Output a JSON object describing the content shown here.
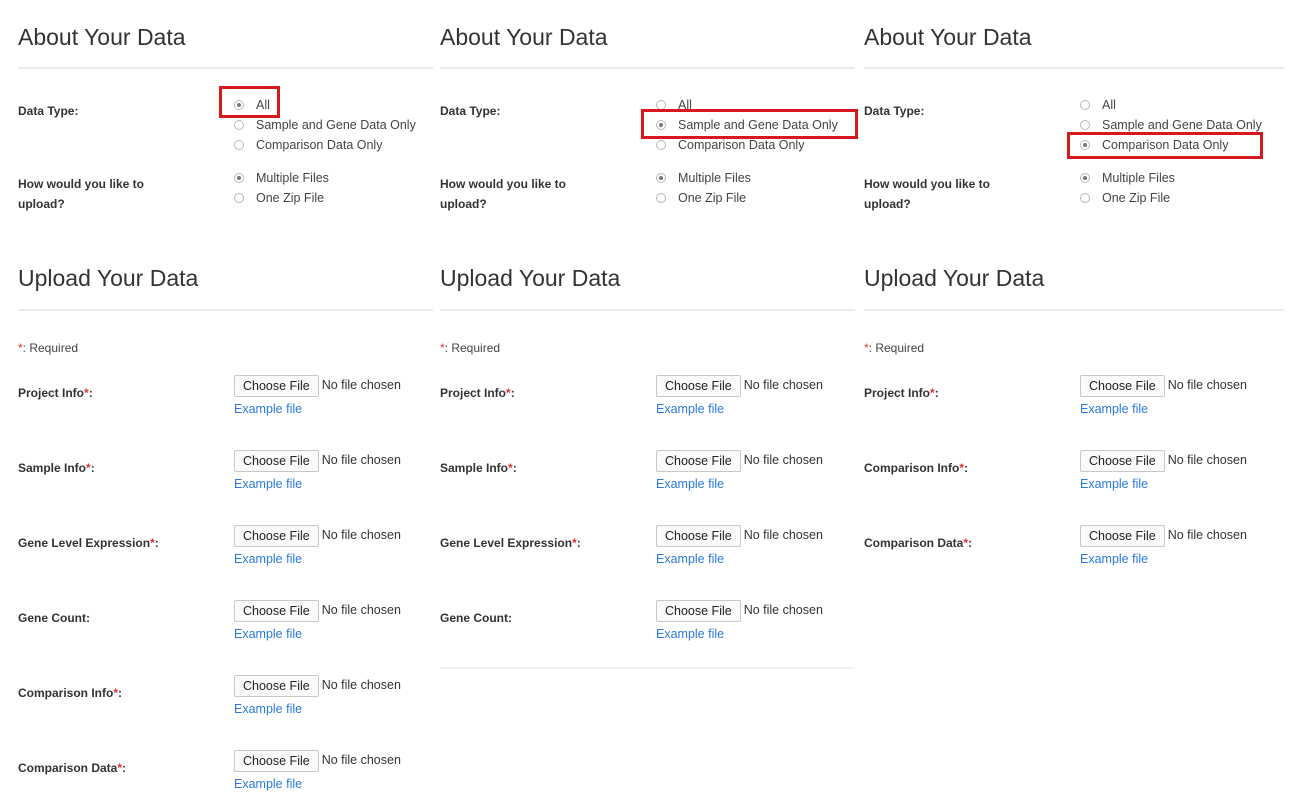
{
  "panels": [
    {
      "about_title": "About Your Data",
      "data_type_label": "Data Type:",
      "data_type_options": [
        "All",
        "Sample and Gene Data Only",
        "Comparison Data Only"
      ],
      "data_type_selected": 0,
      "upload_method_label": "How would you like to upload?",
      "upload_method_options": [
        "Multiple Files",
        "One Zip File"
      ],
      "upload_method_selected": 0,
      "upload_title": "Upload Your Data",
      "required_note": ": Required",
      "fields": [
        {
          "label": "Project Info",
          "required": true,
          "button": "Choose File",
          "status": "No file chosen",
          "example": "Example file"
        },
        {
          "label": "Sample Info",
          "required": true,
          "button": "Choose File",
          "status": "No file chosen",
          "example": "Example file"
        },
        {
          "label": "Gene Level Expression",
          "required": true,
          "button": "Choose File",
          "status": "No file chosen",
          "example": "Example file"
        },
        {
          "label": "Gene Count",
          "required": false,
          "button": "Choose File",
          "status": "No file chosen",
          "example": "Example file"
        },
        {
          "label": "Comparison Info",
          "required": true,
          "button": "Choose File",
          "status": "No file chosen",
          "example": "Example file"
        },
        {
          "label": "Comparison Data",
          "required": true,
          "button": "Choose File",
          "status": "No file chosen",
          "example": "Example file"
        }
      ]
    },
    {
      "about_title": "About Your Data",
      "data_type_label": "Data Type:",
      "data_type_options": [
        "All",
        "Sample and Gene Data Only",
        "Comparison Data Only"
      ],
      "data_type_selected": 1,
      "upload_method_label": "How would you like to upload?",
      "upload_method_options": [
        "Multiple Files",
        "One Zip File"
      ],
      "upload_method_selected": 0,
      "upload_title": "Upload Your Data",
      "required_note": ": Required",
      "fields": [
        {
          "label": "Project Info",
          "required": true,
          "button": "Choose File",
          "status": "No file chosen",
          "example": "Example file"
        },
        {
          "label": "Sample Info",
          "required": true,
          "button": "Choose File",
          "status": "No file chosen",
          "example": "Example file"
        },
        {
          "label": "Gene Level Expression",
          "required": true,
          "button": "Choose File",
          "status": "No file chosen",
          "example": "Example file"
        },
        {
          "label": "Gene Count",
          "required": false,
          "button": "Choose File",
          "status": "No file chosen",
          "example": "Example file"
        }
      ]
    },
    {
      "about_title": "About Your Data",
      "data_type_label": "Data Type:",
      "data_type_options": [
        "All",
        "Sample and Gene Data Only",
        "Comparison Data Only"
      ],
      "data_type_selected": 2,
      "upload_method_label": "How would you like to upload?",
      "upload_method_options": [
        "Multiple Files",
        "One Zip File"
      ],
      "upload_method_selected": 0,
      "upload_title": "Upload Your Data",
      "required_note": ": Required",
      "fields": [
        {
          "label": "Project Info",
          "required": true,
          "button": "Choose File",
          "status": "No file chosen",
          "example": "Example file"
        },
        {
          "label": "Comparison Info",
          "required": true,
          "button": "Choose File",
          "status": "No file chosen",
          "example": "Example file"
        },
        {
          "label": "Comparison Data",
          "required": true,
          "button": "Choose File",
          "status": "No file chosen",
          "example": "Example file"
        }
      ]
    }
  ],
  "colors": {
    "highlight": "#d8181f",
    "required_star": "#e53030",
    "link": "#2a7ae2"
  }
}
